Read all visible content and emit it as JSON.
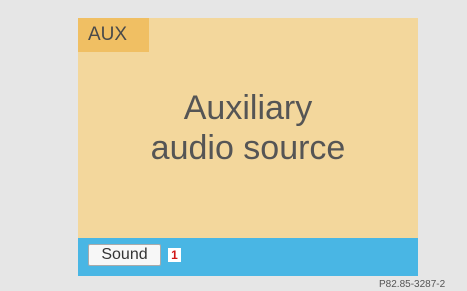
{
  "screen": {
    "tab_label": "AUX",
    "main_text_line1": "Auxiliary",
    "main_text_line2": "audio source",
    "bottom_bar": {
      "sound_label": "Sound",
      "callout_number": "1"
    }
  },
  "reference_code": "P82.85-3287-2",
  "colors": {
    "page_background": "#e6e6e6",
    "screen_background": "#f3d79c",
    "tab_background": "#f0bf63",
    "bottom_bar": "#49b6e4",
    "callout_text": "#d11717"
  }
}
